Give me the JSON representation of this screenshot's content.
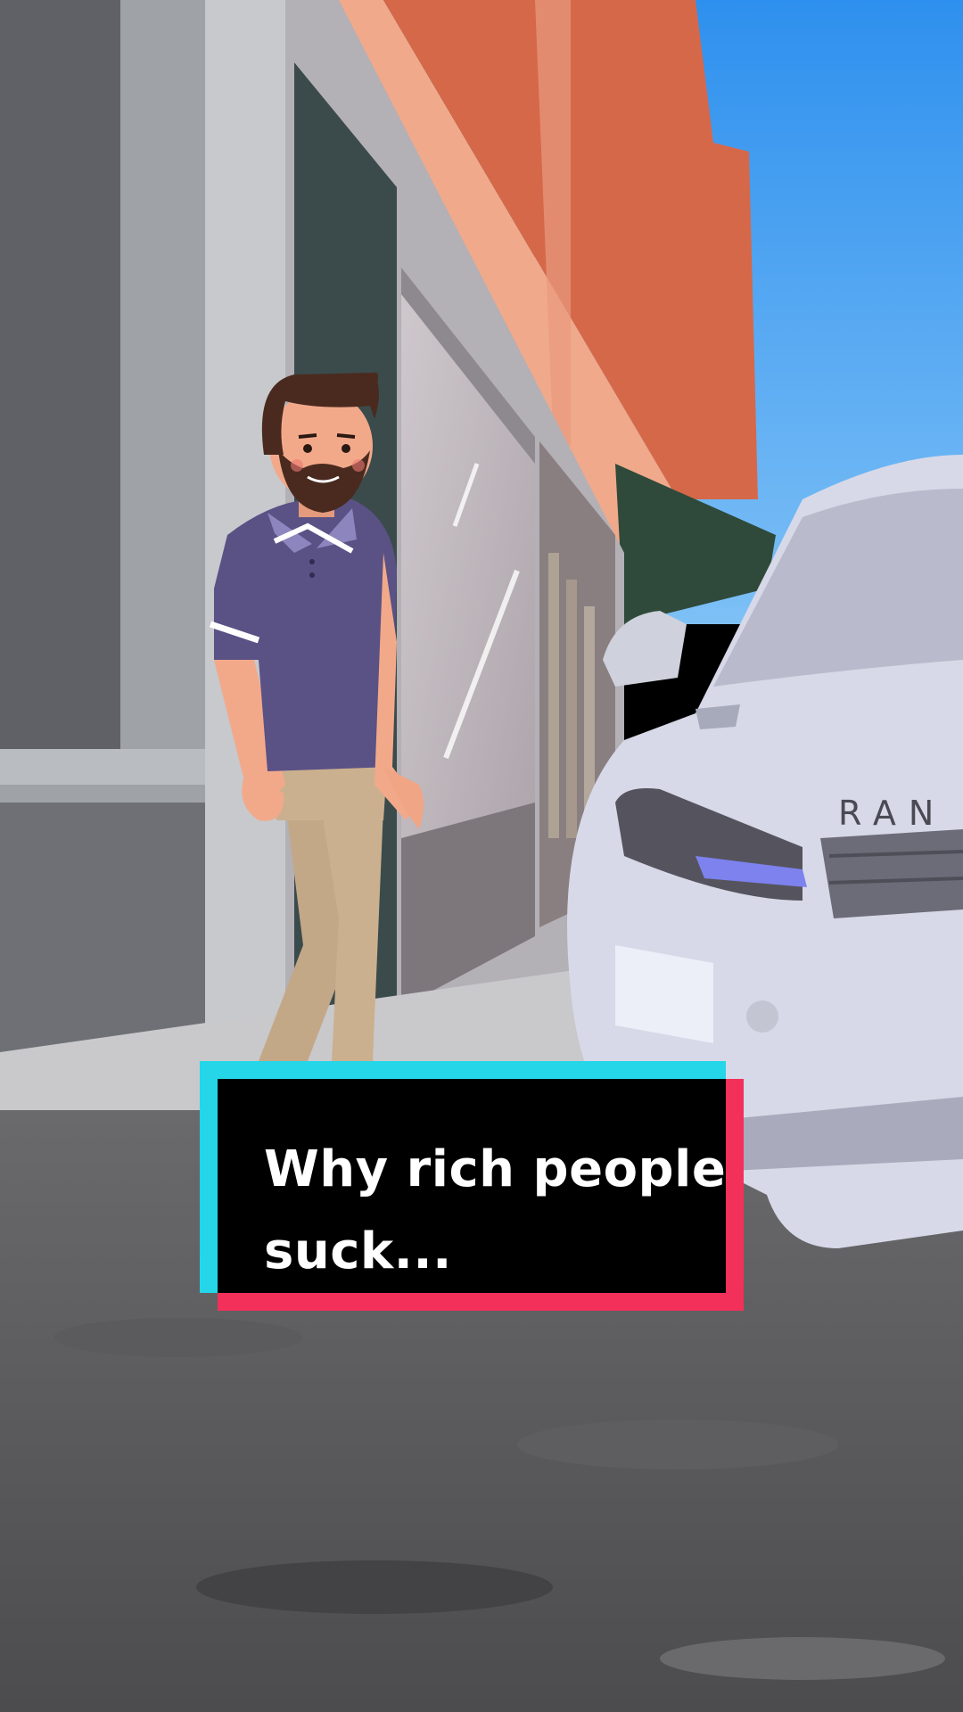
{
  "caption": {
    "text": "Why rich people suck..."
  },
  "car": {
    "badge": "RAN"
  },
  "colors": {
    "sky": "#3f9df0",
    "brick": "#d96b4a",
    "shirt": "#5a5185",
    "pants": "#c8ad8c",
    "car_body": "#d6d8e8",
    "caption_cyan": "#24d6e8",
    "caption_red": "#f2305a"
  }
}
